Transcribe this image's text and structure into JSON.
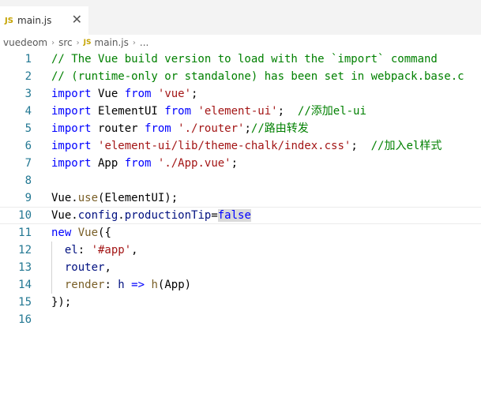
{
  "tab": {
    "icon_text": "JS",
    "filename": "main.js",
    "close_glyph": "✕"
  },
  "breadcrumb": {
    "items": [
      "vuedeom",
      "src",
      "main.js",
      "..."
    ],
    "js_icon_text": "JS"
  },
  "editor": {
    "lines": [
      {
        "num": "1",
        "tokens": [
          {
            "t": "comment",
            "v": "// The Vue build version to load with the `import` command"
          }
        ]
      },
      {
        "num": "2",
        "tokens": [
          {
            "t": "comment",
            "v": "// (runtime-only or standalone) has been set in webpack.base.c"
          }
        ]
      },
      {
        "num": "3",
        "tokens": [
          {
            "t": "keyword",
            "v": "import"
          },
          {
            "t": "plain",
            "v": " Vue "
          },
          {
            "t": "keyword",
            "v": "from"
          },
          {
            "t": "plain",
            "v": " "
          },
          {
            "t": "string",
            "v": "'vue'"
          },
          {
            "t": "plain",
            "v": ";"
          }
        ]
      },
      {
        "num": "4",
        "tokens": [
          {
            "t": "keyword",
            "v": "import"
          },
          {
            "t": "plain",
            "v": " ElementUI "
          },
          {
            "t": "keyword",
            "v": "from"
          },
          {
            "t": "plain",
            "v": " "
          },
          {
            "t": "string",
            "v": "'element-ui'"
          },
          {
            "t": "plain",
            "v": ";  "
          },
          {
            "t": "comment",
            "v": "//添加el-ui"
          }
        ]
      },
      {
        "num": "5",
        "tokens": [
          {
            "t": "keyword",
            "v": "import"
          },
          {
            "t": "plain",
            "v": " router "
          },
          {
            "t": "keyword",
            "v": "from"
          },
          {
            "t": "plain",
            "v": " "
          },
          {
            "t": "string",
            "v": "'./router'"
          },
          {
            "t": "plain",
            "v": ";"
          },
          {
            "t": "comment",
            "v": "//路由转发"
          }
        ]
      },
      {
        "num": "6",
        "tokens": [
          {
            "t": "keyword",
            "v": "import"
          },
          {
            "t": "plain",
            "v": " "
          },
          {
            "t": "string",
            "v": "'element-ui/lib/theme-chalk/index.css'"
          },
          {
            "t": "plain",
            "v": ";  "
          },
          {
            "t": "comment",
            "v": "//加入el样式"
          }
        ]
      },
      {
        "num": "7",
        "tokens": [
          {
            "t": "keyword",
            "v": "import"
          },
          {
            "t": "plain",
            "v": " App "
          },
          {
            "t": "keyword",
            "v": "from"
          },
          {
            "t": "plain",
            "v": " "
          },
          {
            "t": "string",
            "v": "'./App.vue'"
          },
          {
            "t": "plain",
            "v": ";"
          }
        ]
      },
      {
        "num": "8",
        "tokens": []
      },
      {
        "num": "9",
        "tokens": [
          {
            "t": "plain",
            "v": "Vue."
          },
          {
            "t": "func",
            "v": "use"
          },
          {
            "t": "plain",
            "v": "(ElementUI);"
          }
        ]
      },
      {
        "num": "10",
        "current": true,
        "tokens": [
          {
            "t": "plain",
            "v": "Vue."
          },
          {
            "t": "ident",
            "v": "config"
          },
          {
            "t": "plain",
            "v": "."
          },
          {
            "t": "ident",
            "v": "productionTip"
          },
          {
            "t": "plain",
            "v": "="
          },
          {
            "t": "const",
            "v": "false"
          }
        ]
      },
      {
        "num": "11",
        "tokens": [
          {
            "t": "keyword",
            "v": "new"
          },
          {
            "t": "plain",
            "v": " "
          },
          {
            "t": "func",
            "v": "Vue"
          },
          {
            "t": "plain",
            "v": "({"
          }
        ]
      },
      {
        "num": "12",
        "tokens": [
          {
            "t": "plain",
            "v": "  "
          },
          {
            "t": "ident",
            "v": "el"
          },
          {
            "t": "plain",
            "v": ": "
          },
          {
            "t": "string",
            "v": "'#app'"
          },
          {
            "t": "plain",
            "v": ","
          }
        ]
      },
      {
        "num": "13",
        "tokens": [
          {
            "t": "plain",
            "v": "  "
          },
          {
            "t": "ident",
            "v": "router"
          },
          {
            "t": "plain",
            "v": ","
          }
        ]
      },
      {
        "num": "14",
        "tokens": [
          {
            "t": "plain",
            "v": "  "
          },
          {
            "t": "func",
            "v": "render"
          },
          {
            "t": "plain",
            "v": ": "
          },
          {
            "t": "ident",
            "v": "h"
          },
          {
            "t": "plain",
            "v": " "
          },
          {
            "t": "keyword",
            "v": "=>"
          },
          {
            "t": "plain",
            "v": " "
          },
          {
            "t": "func",
            "v": "h"
          },
          {
            "t": "plain",
            "v": "(App)"
          }
        ]
      },
      {
        "num": "15",
        "tokens": [
          {
            "t": "plain",
            "v": "});"
          }
        ]
      },
      {
        "num": "16",
        "tokens": []
      }
    ]
  }
}
